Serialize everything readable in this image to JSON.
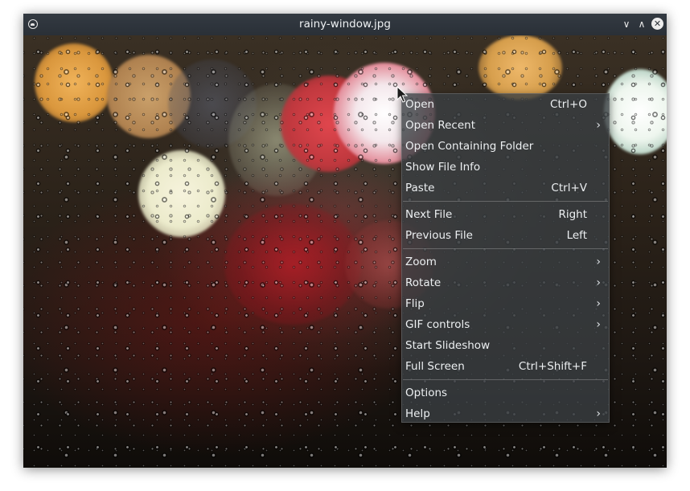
{
  "window": {
    "title": "rainy-window.jpg",
    "icons": {
      "app": "app-icon",
      "minimize": "chevron-down-icon",
      "maximize": "chevron-up-icon",
      "close": "close-icon"
    },
    "minimize_glyph": "∨",
    "maximize_glyph": "∧",
    "close_glyph": "✕"
  },
  "menu": {
    "arrow_glyph": "›",
    "items": [
      {
        "label": "Open",
        "shortcut": "Ctrl+O"
      },
      {
        "label": "Open Recent",
        "submenu": true
      },
      {
        "label": "Open Containing Folder"
      },
      {
        "label": "Show File Info"
      },
      {
        "label": "Paste",
        "shortcut": "Ctrl+V"
      },
      {
        "label": "Next File",
        "shortcut": "Right"
      },
      {
        "label": "Previous File",
        "shortcut": "Left"
      },
      {
        "label": "Zoom",
        "submenu": true
      },
      {
        "label": "Rotate",
        "submenu": true
      },
      {
        "label": "Flip",
        "submenu": true
      },
      {
        "label": "GIF controls",
        "submenu": true
      },
      {
        "label": "Start Slideshow"
      },
      {
        "label": "Full Screen",
        "shortcut": "Ctrl+Shift+F"
      },
      {
        "label": "Options"
      },
      {
        "label": "Help",
        "submenu": true
      }
    ]
  },
  "colors": {
    "titlebar": "#2f353c",
    "menu_bg": "#3a3e42",
    "menu_text": "#eceff1"
  }
}
